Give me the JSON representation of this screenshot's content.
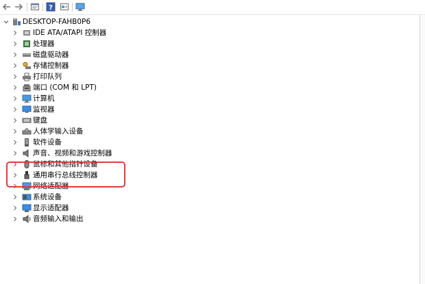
{
  "toolbar": {
    "icons": [
      "back-arrow-icon",
      "forward-arrow-icon",
      "properties-icon",
      "help-icon",
      "update-driver-icon",
      "monitor-icon"
    ]
  },
  "tree": {
    "root": {
      "label": "DESKTOP-FAHB0P6",
      "expanded": true
    },
    "items": [
      {
        "label": "IDE ATA/ATAPI 控制器",
        "icon": "ide-controller-icon"
      },
      {
        "label": "处理器",
        "icon": "processor-icon"
      },
      {
        "label": "磁盘驱动器",
        "icon": "disk-drive-icon"
      },
      {
        "label": "存储控制器",
        "icon": "storage-controller-icon"
      },
      {
        "label": "打印队列",
        "icon": "printer-icon"
      },
      {
        "label": "端口 (COM 和 LPT)",
        "icon": "port-icon"
      },
      {
        "label": "计算机",
        "icon": "computer-icon"
      },
      {
        "label": "监视器",
        "icon": "monitor-icon"
      },
      {
        "label": "键盘",
        "icon": "keyboard-icon"
      },
      {
        "label": "人体学输入设备",
        "icon": "hid-icon"
      },
      {
        "label": "软件设备",
        "icon": "software-device-icon"
      },
      {
        "label": "声音、视频和游戏控制器",
        "icon": "sound-icon"
      },
      {
        "label": "鼠标和其他指针设备",
        "icon": "mouse-icon"
      },
      {
        "label": "通用串行总线控制器",
        "icon": "usb-icon"
      },
      {
        "label": "网络适配器",
        "icon": "network-adapter-icon"
      },
      {
        "label": "系统设备",
        "icon": "system-device-icon"
      },
      {
        "label": "显示适配器",
        "icon": "display-adapter-icon"
      },
      {
        "label": "音频输入和输出",
        "icon": "audio-io-icon"
      }
    ]
  },
  "annotation": {
    "color": "#e23b3b"
  }
}
